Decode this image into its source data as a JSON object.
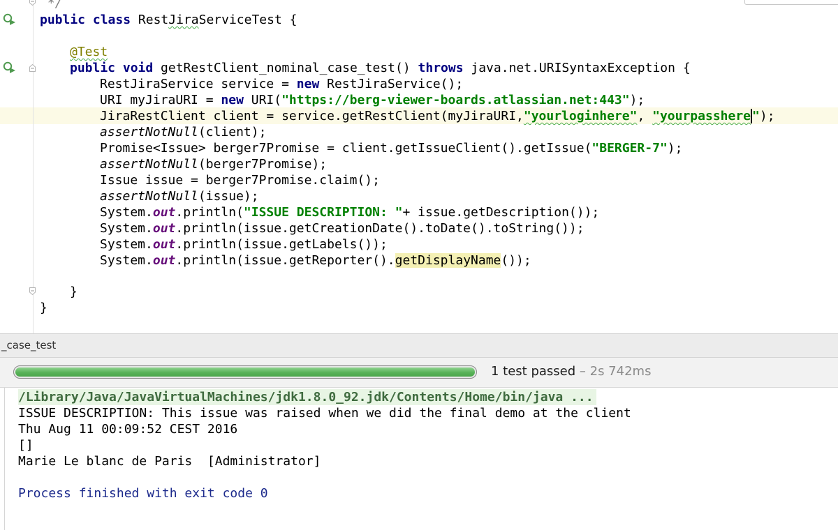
{
  "editor": {
    "comment_end": " */",
    "lines": {
      "class_decl": {
        "kw": "public class ",
        "name_a": "Rest",
        "name_b": "Jira",
        "name_c": "ServiceTest {"
      },
      "annotation": "@Test",
      "method": {
        "kw1": "public void ",
        "sig": "getRestClient_nominal_case_test() ",
        "kw2": "throws",
        "rest": " java.net.URISyntaxException {"
      },
      "l_service": {
        "a": "RestJiraService service = ",
        "kw": "new",
        "b": " RestJiraService();"
      },
      "l_uri": {
        "a": "URI myJiraURI = ",
        "kw": "new",
        "b": " URI(",
        "str": "\"https://berg-viewer-boards.atlassian.net:443\"",
        "c": ");"
      },
      "l_client": {
        "a": "JiraRestClient client = service.getRestClient(myJiraURI,",
        "str1": "\"yourloginhere\"",
        "b": ", ",
        "str2a": "\"yourpasshere",
        "str2b": "\"",
        "c": ");"
      },
      "l_assert1": {
        "st": "assertNotNull",
        "b": "(client);"
      },
      "l_promise": {
        "a": "Promise<Issue> berger7Promise = client.getIssueClient().getIssue(",
        "str": "\"BERGER-7\"",
        "b": ");"
      },
      "l_assert2": {
        "st": "assertNotNull",
        "b": "(berger7Promise);"
      },
      "l_issue": "Issue issue = berger7Promise.claim();",
      "l_assert3": {
        "st": "assertNotNull",
        "b": "(issue);"
      },
      "l_print1": {
        "a": "System.",
        "f": "out",
        "b": ".println(",
        "str": "\"ISSUE DESCRIPTION: \"",
        "c": "+ issue.getDescription());"
      },
      "l_print2": {
        "a": "System.",
        "f": "out",
        "b": ".println(issue.getCreationDate().toDate().toString());"
      },
      "l_print3": {
        "a": "System.",
        "f": "out",
        "b": ".println(issue.getLabels());"
      },
      "l_print4": {
        "a": "System.",
        "f": "out",
        "b": ".println(issue.getReporter().",
        "hl": "getDisplayName",
        "c": "());"
      },
      "close_method": "}",
      "close_class": "}"
    }
  },
  "panel": {
    "title": "_case_test",
    "progress": {
      "fraction": 1.0,
      "status": "1 test passed",
      "time": " – 2s 742ms",
      "color": "#58b258"
    }
  },
  "console": {
    "lines": [
      "/Library/Java/JavaVirtualMachines/jdk1.8.0_92.jdk/Contents/Home/bin/java ...",
      "ISSUE DESCRIPTION: This issue was raised when we did the final demo at the client",
      "Thu Aug 11 00:09:52 CEST 2016",
      "[]",
      "Marie Le blanc de Paris  [Administrator]",
      "Process finished with exit code 0"
    ]
  },
  "icons": {
    "run": "run-test-icon",
    "fold": "fold-icon"
  }
}
